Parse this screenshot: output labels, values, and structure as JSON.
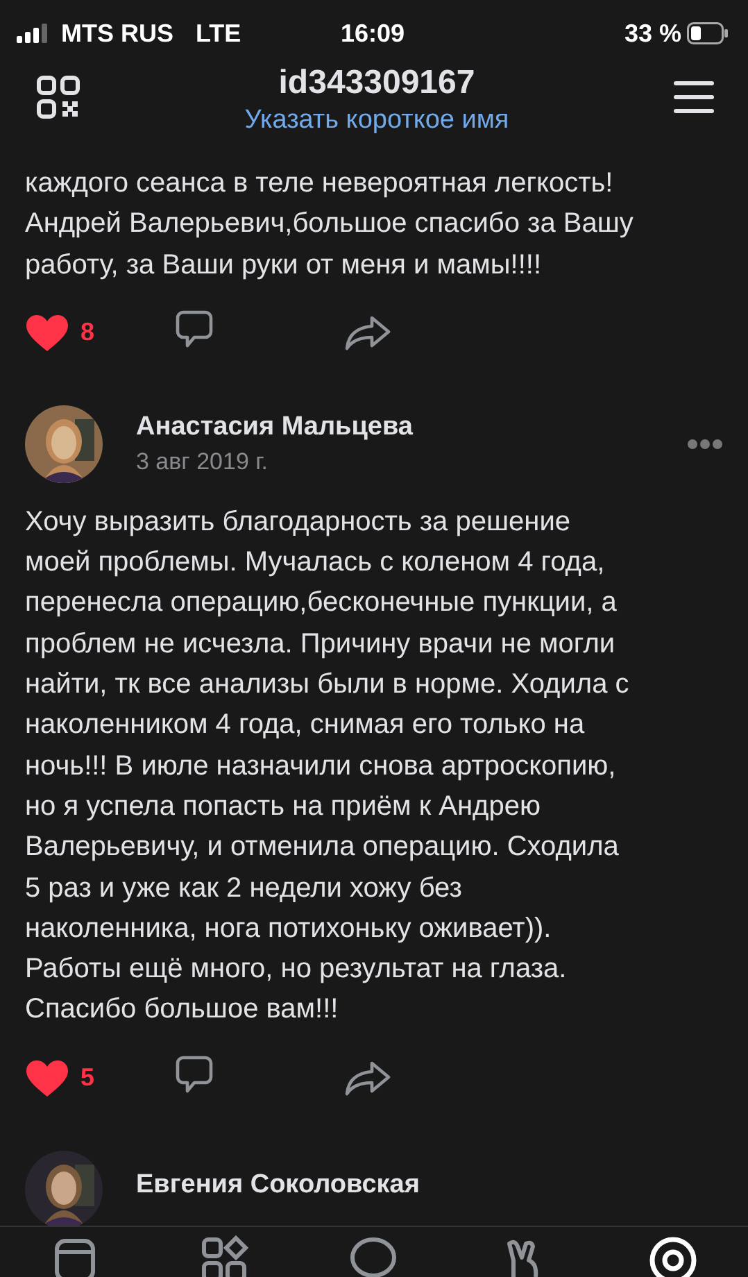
{
  "status_bar": {
    "carrier": "MTS RUS",
    "network": "LTE",
    "time": "16:09",
    "battery": "33 %"
  },
  "header": {
    "title": "id343309167",
    "subtitle": "Указать короткое имя"
  },
  "posts": [
    {
      "text": "каждого сеанса в теле невероятная легкость!\nАндрей Валерьевич,большое спасибо за Вашу\nработу, за Ваши руки от меня и мамы!!!!",
      "likes": "8",
      "liked": true
    },
    {
      "author": "Анастасия Мальцева",
      "date": "3 авг 2019 г.",
      "text": "Хочу выразить благодарность за решение\nмоей проблемы. Мучалась с коленом 4 года,\nперенесла операцию,бесконечные пункции, а\nпроблем  не исчезла. Причину врачи не могли\nнайти, тк все анализы были в норме. Ходила с\nнаколенником 4 года, снимая его только на\nночь!!! В июле назначили снова артроскопию,\nно я успела попасть на приём к Андрею\nВалерьевичу, и отменила операцию. Сходила\n5 раз и уже как 2 недели хожу без\nнаколенника, нога потихоньку оживает)).\nРаботы ещё много, но результат на глаза.\nСпасибо большое вам!!!",
      "likes": "5",
      "liked": true
    },
    {
      "author": "Евгения Соколовская"
    }
  ],
  "tab_bar": {
    "tabs": [
      {
        "kind": "news",
        "selected": false
      },
      {
        "kind": "services",
        "selected": false
      },
      {
        "kind": "messages",
        "selected": false
      },
      {
        "kind": "friends",
        "selected": false
      },
      {
        "kind": "profile",
        "selected": true
      }
    ]
  }
}
